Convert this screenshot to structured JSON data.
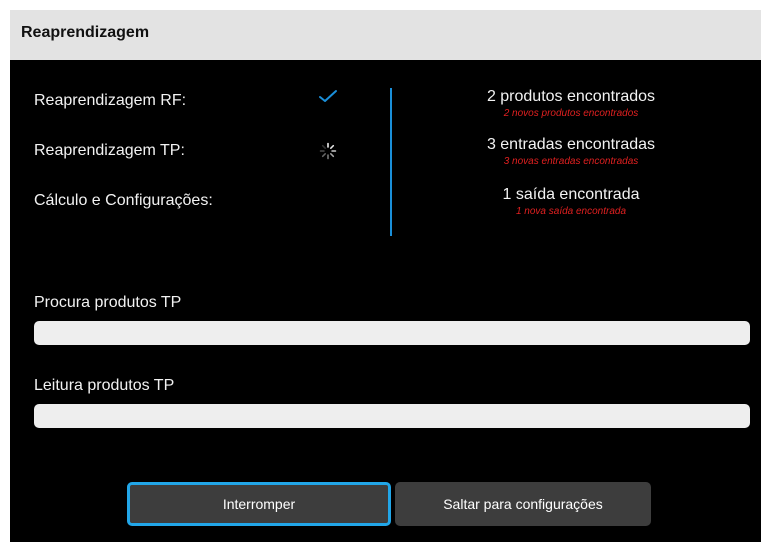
{
  "dialog": {
    "title": "Reaprendizagem"
  },
  "steps": [
    {
      "label": "Reaprendizagem RF:",
      "status": "done",
      "status_icon": "checkmark-icon"
    },
    {
      "label": "Reaprendizagem TP:",
      "status": "in-progress",
      "status_icon": "spinner-icon"
    },
    {
      "label": "Cálculo e Configurações:",
      "status": "pending"
    }
  ],
  "results": [
    {
      "main": "2 produtos encontrados",
      "sub": "2 novos produtos encontrados"
    },
    {
      "main": "3 entradas encontradas",
      "sub": "3 novas entradas encontradas"
    },
    {
      "main": "1 saída encontrada",
      "sub": "1 nova saída encontrada"
    }
  ],
  "progress": [
    {
      "label": "Procura produtos TP",
      "value": 0
    },
    {
      "label": "Leitura produtos TP",
      "value": 0
    }
  ],
  "buttons": {
    "interrupt": "Interromper",
    "skip": "Saltar para configurações"
  },
  "colors": {
    "background": "#000000",
    "titlebar": "#e3e3e3",
    "accent": "#1a8fd9",
    "focus_ring": "#22a6e8",
    "sub_text": "#e02020",
    "button": "#3d3d3d",
    "progress_track": "#eeeeee"
  }
}
